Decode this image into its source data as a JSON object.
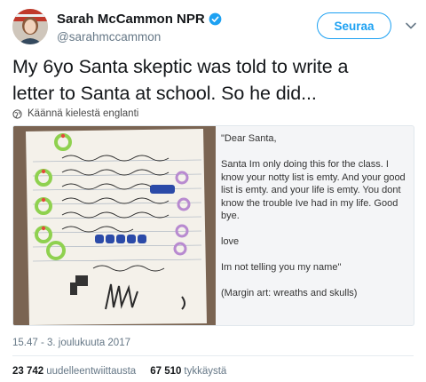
{
  "author": {
    "display_name": "Sarah McCammon NPR",
    "handle": "@sarahmccammon",
    "verified": true,
    "avatar_icon": "avatar-photo"
  },
  "actions": {
    "follow_label": "Seuraa",
    "menu_icon": "chevron-down-icon"
  },
  "tweet": {
    "text_line1": "My 6yo Santa skeptic was told to write a",
    "text_line2": "letter to Santa at school. So he did...",
    "translate_label": "Käännä kielestä englanti",
    "translate_icon": "globe-icon"
  },
  "media": {
    "letter_text": [
      "\"Dear Santa,",
      "Santa Im only doing this for the class. I know your notty list is emty. And your good list is emty. and your life is emty. You dont know the trouble Ive had in my life. Good bye.",
      "love",
      "Im not telling you my name\"",
      "(Margin art: wreaths and skulls)"
    ]
  },
  "meta": {
    "timestamp": "15.47 - 3. joulukuuta 2017",
    "retweets_count": "23 742",
    "retweets_label": "uudelleentwiittausta",
    "likes_count": "67 510",
    "likes_label": "tykkäystä"
  },
  "colors": {
    "accent": "#1da1f2",
    "text": "#14171a",
    "secondary": "#657786"
  }
}
